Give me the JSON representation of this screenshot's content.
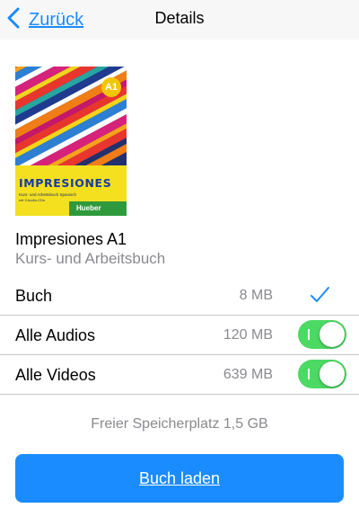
{
  "navbar": {
    "back_label": "Zurück",
    "title": "Details"
  },
  "book": {
    "cover": {
      "badge": "A1",
      "title": "IMPRESIONES",
      "subtitle_line1": "Kurs- und Arbeitsbuch Spanisch",
      "subtitle_line2": "mit 3 Audio-CDs",
      "publisher": "Hueber"
    },
    "title": "Impresiones A1",
    "subtitle": "Kurs- und Arbeitsbuch"
  },
  "downloads": [
    {
      "label": "Buch",
      "size": "8 MB",
      "control": "checkmark",
      "selected": true
    },
    {
      "label": "Alle Audios",
      "size": "120 MB",
      "control": "toggle",
      "enabled": true
    },
    {
      "label": "Alle Videos",
      "size": "639 MB",
      "control": "toggle",
      "enabled": true
    }
  ],
  "storage_text": "Freier Speicherplatz 1,5 GB",
  "load_button_label": "Buch laden",
  "colors": {
    "accent": "#1a8cff",
    "toggle_on": "#4cd964",
    "secondary_text": "#8a8a8f"
  }
}
